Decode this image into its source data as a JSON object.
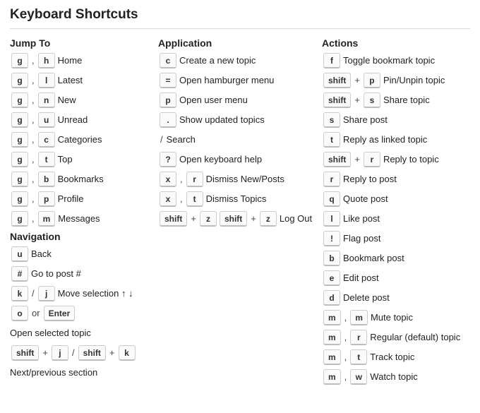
{
  "title": "Keyboard Shortcuts",
  "seps": {
    "comma": ",",
    "plus": "+",
    "slash": "/",
    "or": "or"
  },
  "sections": {
    "jump": {
      "heading": "Jump To",
      "items": [
        {
          "keys": [
            "g",
            ",",
            "h"
          ],
          "label": "Home"
        },
        {
          "keys": [
            "g",
            ",",
            "l"
          ],
          "label": "Latest"
        },
        {
          "keys": [
            "g",
            ",",
            "n"
          ],
          "label": "New"
        },
        {
          "keys": [
            "g",
            ",",
            "u"
          ],
          "label": "Unread"
        },
        {
          "keys": [
            "g",
            ",",
            "c"
          ],
          "label": "Categories"
        },
        {
          "keys": [
            "g",
            ",",
            "t"
          ],
          "label": "Top"
        },
        {
          "keys": [
            "g",
            ",",
            "b"
          ],
          "label": "Bookmarks"
        },
        {
          "keys": [
            "g",
            ",",
            "p"
          ],
          "label": "Profile"
        },
        {
          "keys": [
            "g",
            ",",
            "m"
          ],
          "label": "Messages"
        }
      ]
    },
    "nav": {
      "heading": "Navigation",
      "items": [
        {
          "keys": [
            "u"
          ],
          "label": "Back"
        },
        {
          "keys": [
            "#"
          ],
          "label": "Go to post #"
        },
        {
          "keys": [
            "k",
            "/",
            "j"
          ],
          "label": "Move selection ↑ ↓"
        },
        {
          "keys": [
            "o",
            "or",
            "Enter"
          ],
          "label": "Open selected topic"
        },
        {
          "keys": [
            "shift",
            "+",
            "j",
            "/",
            "shift",
            "+",
            "k"
          ],
          "label": "Next/previous section"
        }
      ]
    },
    "app": {
      "heading": "Application",
      "items": [
        {
          "keys": [
            "c"
          ],
          "label": "Create a new topic"
        },
        {
          "keys": [
            "="
          ],
          "label": "Open hamburger menu"
        },
        {
          "keys": [
            "p"
          ],
          "label": "Open user menu"
        },
        {
          "keys": [
            "."
          ],
          "label": "Show updated topics"
        },
        {
          "keys": [
            "/"
          ],
          "label": "Search"
        },
        {
          "keys": [
            "?"
          ],
          "label": "Open keyboard help"
        },
        {
          "keys": [
            "x",
            ",",
            "r"
          ],
          "label": "Dismiss New/Posts"
        },
        {
          "keys": [
            "x",
            ",",
            "t"
          ],
          "label": "Dismiss Topics"
        },
        {
          "keys": [
            "shift",
            "+",
            "z",
            "shift",
            "+",
            "z"
          ],
          "label": "Log Out"
        }
      ]
    },
    "act": {
      "heading": "Actions",
      "items": [
        {
          "keys": [
            "f"
          ],
          "label": "Toggle bookmark topic"
        },
        {
          "keys": [
            "shift",
            "+",
            "p"
          ],
          "label": "Pin/Unpin topic"
        },
        {
          "keys": [
            "shift",
            "+",
            "s"
          ],
          "label": "Share topic"
        },
        {
          "keys": [
            "s"
          ],
          "label": "Share post"
        },
        {
          "keys": [
            "t"
          ],
          "label": "Reply as linked topic"
        },
        {
          "keys": [
            "shift",
            "+",
            "r"
          ],
          "label": "Reply to topic"
        },
        {
          "keys": [
            "r"
          ],
          "label": "Reply to post"
        },
        {
          "keys": [
            "q"
          ],
          "label": "Quote post"
        },
        {
          "keys": [
            "l"
          ],
          "label": "Like post"
        },
        {
          "keys": [
            "!"
          ],
          "label": "Flag post"
        },
        {
          "keys": [
            "b"
          ],
          "label": "Bookmark post"
        },
        {
          "keys": [
            "e"
          ],
          "label": "Edit post"
        },
        {
          "keys": [
            "d"
          ],
          "label": "Delete post"
        },
        {
          "keys": [
            "m",
            ",",
            "m"
          ],
          "label": "Mute topic"
        },
        {
          "keys": [
            "m",
            ",",
            "r"
          ],
          "label": "Regular (default) topic"
        },
        {
          "keys": [
            "m",
            ",",
            "t"
          ],
          "label": "Track topic"
        },
        {
          "keys": [
            "m",
            ",",
            "w"
          ],
          "label": "Watch topic"
        }
      ]
    }
  }
}
